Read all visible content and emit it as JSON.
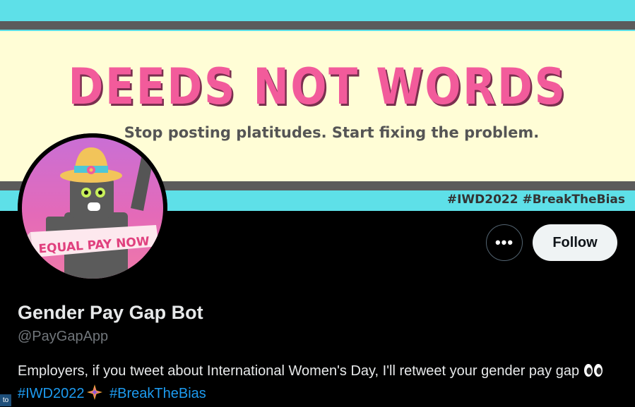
{
  "banner": {
    "headline": "DEEDS NOT WORDS",
    "subline": "Stop posting platitudes. Start fixing the problem.",
    "hashtags": "#IWD2022 #BreakTheBias",
    "colors": {
      "cyan": "#5ee0e8",
      "cream": "#fffdd6",
      "pink": "#f25b9b",
      "stripe": "#5b5b5b"
    }
  },
  "avatar": {
    "ribbon_text": "EQUAL PAY NOW"
  },
  "actions": {
    "more_label": "•••",
    "follow_label": "Follow"
  },
  "profile": {
    "display_name": "Gender Pay Gap Bot",
    "handle": "@PayGapApp",
    "bio_text": "Employers, if you tweet about International Women's Day, I'll retweet your gender pay gap",
    "bio_hashtag_1": "#IWD2022",
    "bio_hashtag_2": "#BreakTheBias",
    "bio_emoji_1": "eyes-icon",
    "bio_emoji_2": "iwd-sparkle-icon"
  },
  "corner_tab": {
    "label": "to"
  }
}
